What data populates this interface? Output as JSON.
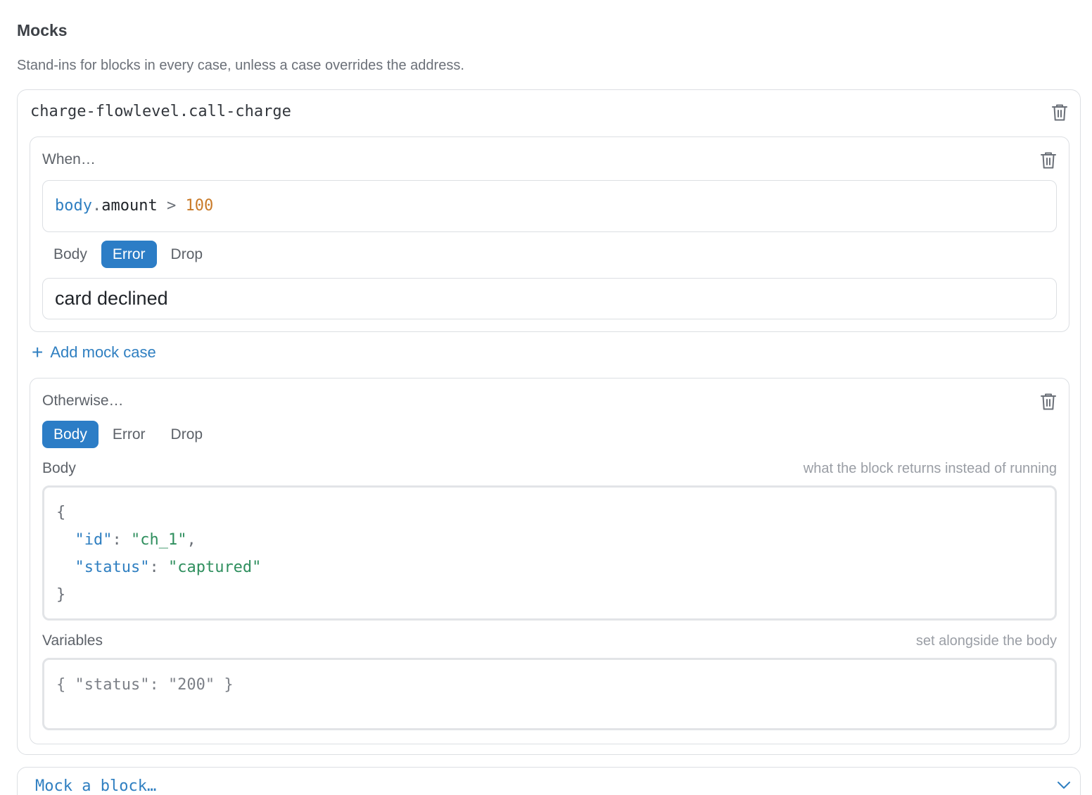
{
  "section": {
    "title": "Mocks",
    "description": "Stand-ins for blocks in every case, unless a case overrides the address."
  },
  "mock": {
    "address": "charge-flowlevel.call-charge",
    "when_case": {
      "label": "When…",
      "condition": {
        "ident": "body",
        "dot": ".",
        "prop": "amount",
        "op": " > ",
        "value": "100"
      },
      "modes": [
        "Body",
        "Error",
        "Drop"
      ],
      "active_mode": "Error",
      "error_value": "card declined"
    },
    "add_case_label": "Add mock case",
    "otherwise_case": {
      "label": "Otherwise…",
      "modes": [
        "Body",
        "Error",
        "Drop"
      ],
      "active_mode": "Body",
      "body_label": "Body",
      "body_hint": "what the block returns instead of running",
      "body_json": {
        "open": "{",
        "lines": [
          {
            "key": "\"id\"",
            "value": "\"ch_1\"",
            "trail": ","
          },
          {
            "key": "\"status\"",
            "value": "\"captured\"",
            "trail": ""
          }
        ],
        "close": "}"
      },
      "variables_label": "Variables",
      "variables_hint": "set alongside the body",
      "variables_placeholder": "{ \"status\": \"200\" }"
    }
  },
  "mock_select": {
    "placeholder": "Mock a block…"
  },
  "colors": {
    "accent": "#2c7dc6",
    "link": "#2f7fc1",
    "json_key": "#2f7fc1",
    "json_string": "#2f8f5e",
    "number": "#c97a28"
  },
  "icons": [
    "trash-icon",
    "plus-icon",
    "chevron-down-icon"
  ]
}
